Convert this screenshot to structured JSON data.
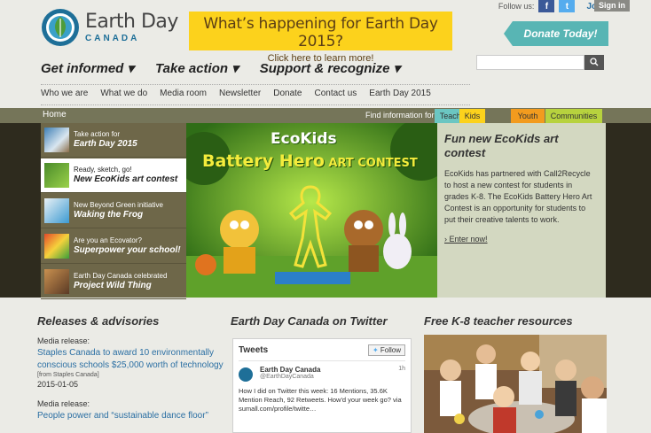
{
  "header": {
    "logo_title": "Earth Day",
    "logo_subtitle": "CANADA",
    "promo_title": "What’s happening for Earth Day 2015?",
    "promo_subtitle": "Click here to learn more!",
    "follow_label": "Follow us:",
    "facebook_icon": "f",
    "twitter_icon": "t",
    "join_label": "Join",
    "signin_label": "Sign in",
    "donate_label": "Donate Today!",
    "search_placeholder": ""
  },
  "main_nav": [
    {
      "label": "Get informed",
      "caret": "▾"
    },
    {
      "label": "Take action",
      "caret": "▾"
    },
    {
      "label": "Support & recognize",
      "caret": "▾"
    }
  ],
  "sub_nav": [
    "Who we are",
    "What we do",
    "Media room",
    "Newsletter",
    "Donate",
    "Contact us",
    "Earth Day 2015"
  ],
  "band": {
    "home_label": "Home",
    "find_label": "Find information for:",
    "tags": [
      {
        "label": "Teachers",
        "color": "#6bc6c2"
      },
      {
        "label": "Kids",
        "color": "#fcd21c"
      },
      {
        "label": "Youth",
        "color": "#f29b1e"
      },
      {
        "label": "Communities",
        "color": "#b7d23e"
      }
    ]
  },
  "slides": [
    {
      "small": "Take action for",
      "big": "Earth Day 2015"
    },
    {
      "small": "Ready, sketch, go!",
      "big": "New EcoKids art contest"
    },
    {
      "small": "New Beyond Green initiative",
      "big": "Waking the Frog"
    },
    {
      "small": "Are you an Ecovator?",
      "big": "Superpower your school!"
    },
    {
      "small": "Earth Day Canada celebrated",
      "big": "Project Wild Thing"
    }
  ],
  "feature": {
    "brand": "EcoKids",
    "title_main": "Battery Hero",
    "title_tail": "ART CONTEST"
  },
  "feature_panel": {
    "title": "Fun new EcoKids art contest",
    "body": "EcoKids has partnered with Call2Recycle to host a new contest for students in grades K-8. The EcoKids Battery Hero Art Contest is an opportunity for students to put their creative talents to work.",
    "link": "Enter now!"
  },
  "releases": {
    "heading": "Releases & advisories",
    "items": [
      {
        "label": "Media release:",
        "link": "Staples Canada to award 10 environmentally conscious schools $25,000 worth of technology",
        "source": "[from Staples Canada]",
        "date": "2015-01-05"
      },
      {
        "label": "Media release:",
        "link": "People power and “sustainable dance floor”"
      }
    ]
  },
  "twitter": {
    "heading": "Earth Day Canada on Twitter",
    "widget_title": "Tweets",
    "follow_label": "Follow",
    "name": "Earth Day Canada",
    "handle": "@EarthDayCanada",
    "time": "1h",
    "body": "How I did on Twitter this week: 16 Mentions, 35.6K Mention Reach, 92 Retweets. How'd your week go? via sumall.com/profile/twitte…"
  },
  "resources": {
    "heading": "Free K-8 teacher resources"
  }
}
